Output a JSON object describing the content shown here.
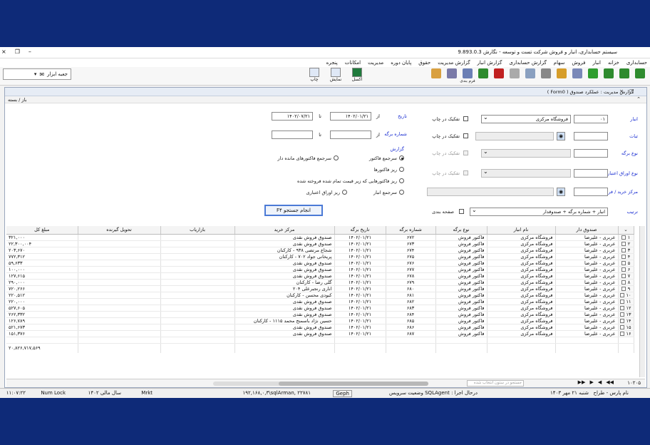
{
  "window": {
    "title": "سیستم حسابداری، انبار و فروش شرکت تست و توسعه - نگارش 9.893.0.3",
    "controls": [
      "×",
      "❐",
      "–"
    ]
  },
  "menu": [
    "حسابداری",
    "خزانه",
    "انبار",
    "فروش",
    "سهام",
    "گزارش حسابداری",
    "گزارش انبار",
    "گزارش مدیریت",
    "حقوق",
    "پایان دوره",
    "مدیریت",
    "امکانات",
    "پنجره"
  ],
  "toolbar": {
    "buttons": [
      {
        "icon": "refresh-icon",
        "color": "#2e8b2e",
        "label": ""
      },
      {
        "icon": "arrow-right-icon",
        "color": "#2e8b2e",
        "label": ""
      },
      {
        "icon": "arrow-left-icon",
        "color": "#2e8b2e",
        "label": ""
      },
      {
        "icon": "add-icon",
        "color": "#2e9d2e",
        "label": ""
      },
      {
        "icon": "copy-icon",
        "color": "#7a88b8",
        "label": ""
      },
      {
        "icon": "edit-icon",
        "color": "#d69d2a",
        "label": ""
      },
      {
        "icon": "delete-icon",
        "color": "#888888",
        "label": ""
      },
      {
        "icon": "print-preview-icon",
        "color": "#8aa0c0",
        "label": ""
      },
      {
        "icon": "document-icon",
        "color": "#aaaaaa",
        "label": ""
      },
      {
        "icon": "cancel-icon",
        "color": "#c02020",
        "label": ""
      },
      {
        "icon": "check-icon",
        "color": "#2e8b2e",
        "label": ""
      },
      {
        "icon": "form-design-icon",
        "color": "#6b7fb5",
        "label": "فرم بندی"
      },
      {
        "icon": "user-icon",
        "color": "#7a7aa8",
        "label": ""
      },
      {
        "icon": "chart-icon",
        "color": "#d9a040",
        "label": ""
      }
    ],
    "big_buttons": [
      {
        "icon": "excel-icon",
        "label": "اکسل"
      },
      {
        "icon": "display-icon",
        "label": "نمایش"
      },
      {
        "icon": "print-icon",
        "label": "چاپ"
      }
    ],
    "group_label": "جعبه ابزار"
  },
  "form": {
    "title": "گزارش مدیریت : عملکرد صندوق ( Form0 )",
    "sub_bar": "باز / بسته"
  },
  "params": {
    "warehouse_label": "انبار",
    "warehouse_code": "۰۱",
    "warehouse_name": "فروشگاه مرکزی",
    "warehouse_split": "تفکیک در چاپ",
    "fund_label": "ثبات",
    "fund_split": "تفکیک در چاپ",
    "doc_type_label": "نوع برگه",
    "doc_type_split": "تفکیک در چاپ",
    "credit_label": "نوع اوراق اعتباری",
    "credit_split": "تفکیک در چاپ",
    "center_label": "مرکز خرید / فروش",
    "date_label": "تاریخ",
    "date_from_lbl": "از",
    "date_from": "۱۴۰۲/۰۱/۲۱",
    "date_to_lbl": "تا",
    "date_to": "۱۴۰۲/۰۷/۲۱",
    "docno_label": "شماره برگه",
    "docno_from_lbl": "از",
    "docno_to_lbl": "تا",
    "report_label": "گزارش",
    "opt1": "سرجمع فاکتور",
    "opt2": "سرجمع فاکتورهای مانده دار",
    "opt3": "ریز فاکتورها",
    "opt4": "ریز فاکتورهایی که زیر قیمت تمام شده فروخته شده",
    "opt5": "سرجمع انبار",
    "opt6": "ریز اوراق اعتباری",
    "sort_label": "ترتیب",
    "sort_value": "انبار + شماره برگه + صندوقدار",
    "page_break": "صفحه بندی",
    "run_button": "انجام جستجو F۴"
  },
  "grid": {
    "columns": [
      "صندوق دار",
      "نام انبار",
      "نوع برگه",
      "شماره برگه",
      "تاریخ برگه",
      "مرکز خرید",
      "بازاریاب",
      "تحویل گیرنده",
      "مبلغ کل"
    ],
    "rows": [
      [
        "عربری - علیرضا",
        "فروشگاه مرکزی",
        "فاکتور فروش",
        "۶۷۲",
        "۱۴۰۲/۰۱/۲۱",
        "صندوق فروش نقدی",
        "",
        "",
        "۳۲۱,۰۰۰"
      ],
      [
        "عربری - علیرضا",
        "فروشگاه مرکزی",
        "فاکتور فروش",
        "۶۷۳",
        "۱۴۰۲/۰۱/۲۱",
        "صندوق فروش نقدی",
        "",
        "",
        "۲۲,۳۰۰,۰۰۴"
      ],
      [
        "عربری - علیرضا",
        "فروشگاه مرکزی",
        "فاکتور فروش",
        "۶۷۴",
        "۱۴۰۲/۰۱/۲۱",
        "شجاع مرتضی ۹۳۸ - کارکنان",
        "",
        "",
        "۲۰۳,۶۷۰"
      ],
      [
        "عربری - علیرضا",
        "فروشگاه مرکزی",
        "فاکتور فروش",
        "۶۷۵",
        "۱۴۰۲/۰۱/۲۱",
        "پریخانی جواد ۷۰۲ - کارکنان",
        "",
        "",
        "۷۷۲,۳۱۲"
      ],
      [
        "عربری - علیرضا",
        "فروشگاه مرکزی",
        "فاکتور فروش",
        "۶۷۶",
        "۱۴۰۲/۰۱/۲۱",
        "صندوق فروش نقدی",
        "",
        "",
        "۵۹,۶۳۳"
      ],
      [
        "عربری - علیرضا",
        "فروشگاه مرکزی",
        "فاکتور فروش",
        "۶۷۷",
        "۱۴۰۲/۰۱/۲۱",
        "صندوق فروش نقدی",
        "",
        "",
        "۱۰۰,۰۰۰"
      ],
      [
        "عربری - علیرضا",
        "فروشگاه مرکزی",
        "فاکتور فروش",
        "۶۷۸",
        "۱۴۰۲/۰۱/۲۱",
        "صندوق فروش نقدی",
        "",
        "",
        "۱۲۷,۶۱۵"
      ],
      [
        "عربری - علیرضا",
        "فروشگاه مرکزی",
        "فاکتور فروش",
        "۶۷۹",
        "۱۴۰۲/۰۱/۲۱",
        "گلی رضا - کارکنان",
        "",
        "",
        "۲۹۰,۰۰۰"
      ],
      [
        "عربری - علیرضا",
        "فروشگاه مرکزی",
        "فاکتور فروش",
        "۶۸۰",
        "۱۴۰۲/۰۱/۲۱",
        "اناری رنجبرعلی ۲۰۴",
        "",
        "",
        "۷۲۰,۲۶۶"
      ],
      [
        "عربری - علیرضا",
        "فروشگاه مرکزی",
        "فاکتور فروش",
        "۶۸۱",
        "۱۴۰۲/۰۱/۲۱",
        "کبودی محسن - کارکنان",
        "",
        "",
        "۲۲۰,۵۱۲"
      ],
      [
        "عربری - علیرضا",
        "فروشگاه مرکزی",
        "فاکتور فروش",
        "۶۸۲",
        "۱۴۰۲/۰۱/۲۱",
        "صندوق فروش نقدی",
        "",
        "",
        "۲۲۰,۰۰۰"
      ],
      [
        "عربری - علیرضا",
        "فروشگاه مرکزی",
        "فاکتور فروش",
        "۶۸۳",
        "۱۴۰۲/۰۱/۲۱",
        "صندوق فروش نقدی",
        "",
        "",
        "۵۲۷,۶۰۵"
      ],
      [
        "عربری - علیرضا",
        "فروشگاه مرکزی",
        "فاکتور فروش",
        "۶۸۴",
        "۱۴۰۲/۰۱/۲۱",
        "صندوق فروش نقدی",
        "",
        "",
        "۲۶۲,۳۳۲"
      ],
      [
        "عربری - علیرضا",
        "فروشگاه مرکزی",
        "فاکتور فروش",
        "۶۸۵",
        "۱۴۰۲/۰۱/۲۱",
        "حسین نژاد باسمنج محمد ۱۱۱۵ - کارکنان",
        "",
        "",
        "۱۲۶,۷۸۹"
      ],
      [
        "عربری - علیرضا",
        "فروشگاه مرکزی",
        "فاکتور فروش",
        "۶۸۶",
        "۱۴۰۲/۰۱/۲۱",
        "صندوق فروش نقدی",
        "",
        "",
        "۵۲۱,۶۷۳"
      ],
      [
        "عربری - علیرضا",
        "فروشگاه مرکزی",
        "فاکتور فروش",
        "۶۸۷",
        "۱۴۰۲/۰۱/۲۱",
        "صندوق فروش نقدی",
        "",
        "",
        "۱۵۱,۳۷۶"
      ]
    ],
    "row_numbers": [
      "۱",
      "۲",
      "۳",
      "۴",
      "۵",
      "۶",
      "۷",
      "۸",
      "۹",
      "۱۰",
      "۱۱",
      "۱۲",
      "۱۳",
      "۱۴",
      "۱۵",
      "۱۶"
    ],
    "total": "۲۰,۸۲۶,۷۱۷,۵۶۹"
  },
  "pager": {
    "count": "۱۰۲۰۵",
    "search_placeholder": "جستجو در ستون انتخاب شده"
  },
  "status": {
    "user": "نام پارس - طراح",
    "date": "شنبه ۲۱ مهر ۱۴۰۳",
    "service": "درحال اجرا : SQLAgent وضعیت سرویس",
    "geph": "Geph",
    "server": "۱۹۲,۱۶۸,۰,۳\\sqlArman, ۲۲۷۸۱",
    "mrkt": "Mrkt",
    "fiscal": "سال مالی ۱۴۰۲",
    "numlock": "Num Lock",
    "time": "۱۱:۰۷:۲۲"
  }
}
